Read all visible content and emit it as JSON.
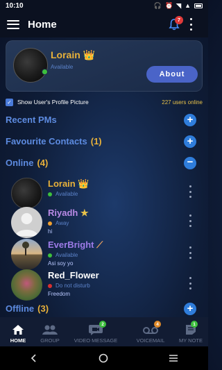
{
  "status_bar": {
    "time": "10:10"
  },
  "app_bar": {
    "title": "Home",
    "notification_count": "7"
  },
  "profile": {
    "name": "Lorain",
    "status": "Available",
    "about_label": "About"
  },
  "show_profile_picture": {
    "label": "Show User's Profile Picture",
    "checked": true,
    "users_online": "227 users online"
  },
  "sections": {
    "recent_pms": {
      "label": "Recent PMs"
    },
    "favourite": {
      "label": "Favourite Contacts",
      "count": "(1)"
    },
    "online": {
      "label": "Online",
      "count": "(4)"
    },
    "offline": {
      "label": "Offline",
      "count": "(3)"
    }
  },
  "contacts": [
    {
      "name": "Lorain",
      "status": "Available",
      "message": "",
      "name_color": "#e8b13a",
      "status_color": "#3dbf3d",
      "badge_icon": "crown-icon"
    },
    {
      "name": "Riyadh",
      "status": "Away",
      "message": "hi",
      "name_color": "#b98ae6",
      "status_color": "#f0a030",
      "badge_icon": "star-icon"
    },
    {
      "name": "EverBright",
      "status": "Available",
      "message": "Asi soy yo",
      "name_color": "#9d7be8",
      "status_color": "#3dbf3d",
      "badge_icon": "wand-icon"
    },
    {
      "name": "Red_Flower",
      "status": "Do not disturb",
      "message": "Freedom",
      "name_color": "#ffffff",
      "status_color": "#d83030",
      "badge_icon": ""
    }
  ],
  "bottom_nav": [
    {
      "label": "HOME",
      "active": true,
      "badge": ""
    },
    {
      "label": "GROUP",
      "active": false,
      "badge": ""
    },
    {
      "label": "VIDEO MESSAGE",
      "active": false,
      "badge": "2"
    },
    {
      "label": "VOICEMAIL",
      "active": false,
      "badge": "4"
    },
    {
      "label": "MY NOTE",
      "active": false,
      "badge": "1"
    }
  ],
  "colors": {
    "accent": "#2f7ddb",
    "section_header": "#5d8be0",
    "gold": "#e8b13a",
    "background": "#0f1d38"
  }
}
